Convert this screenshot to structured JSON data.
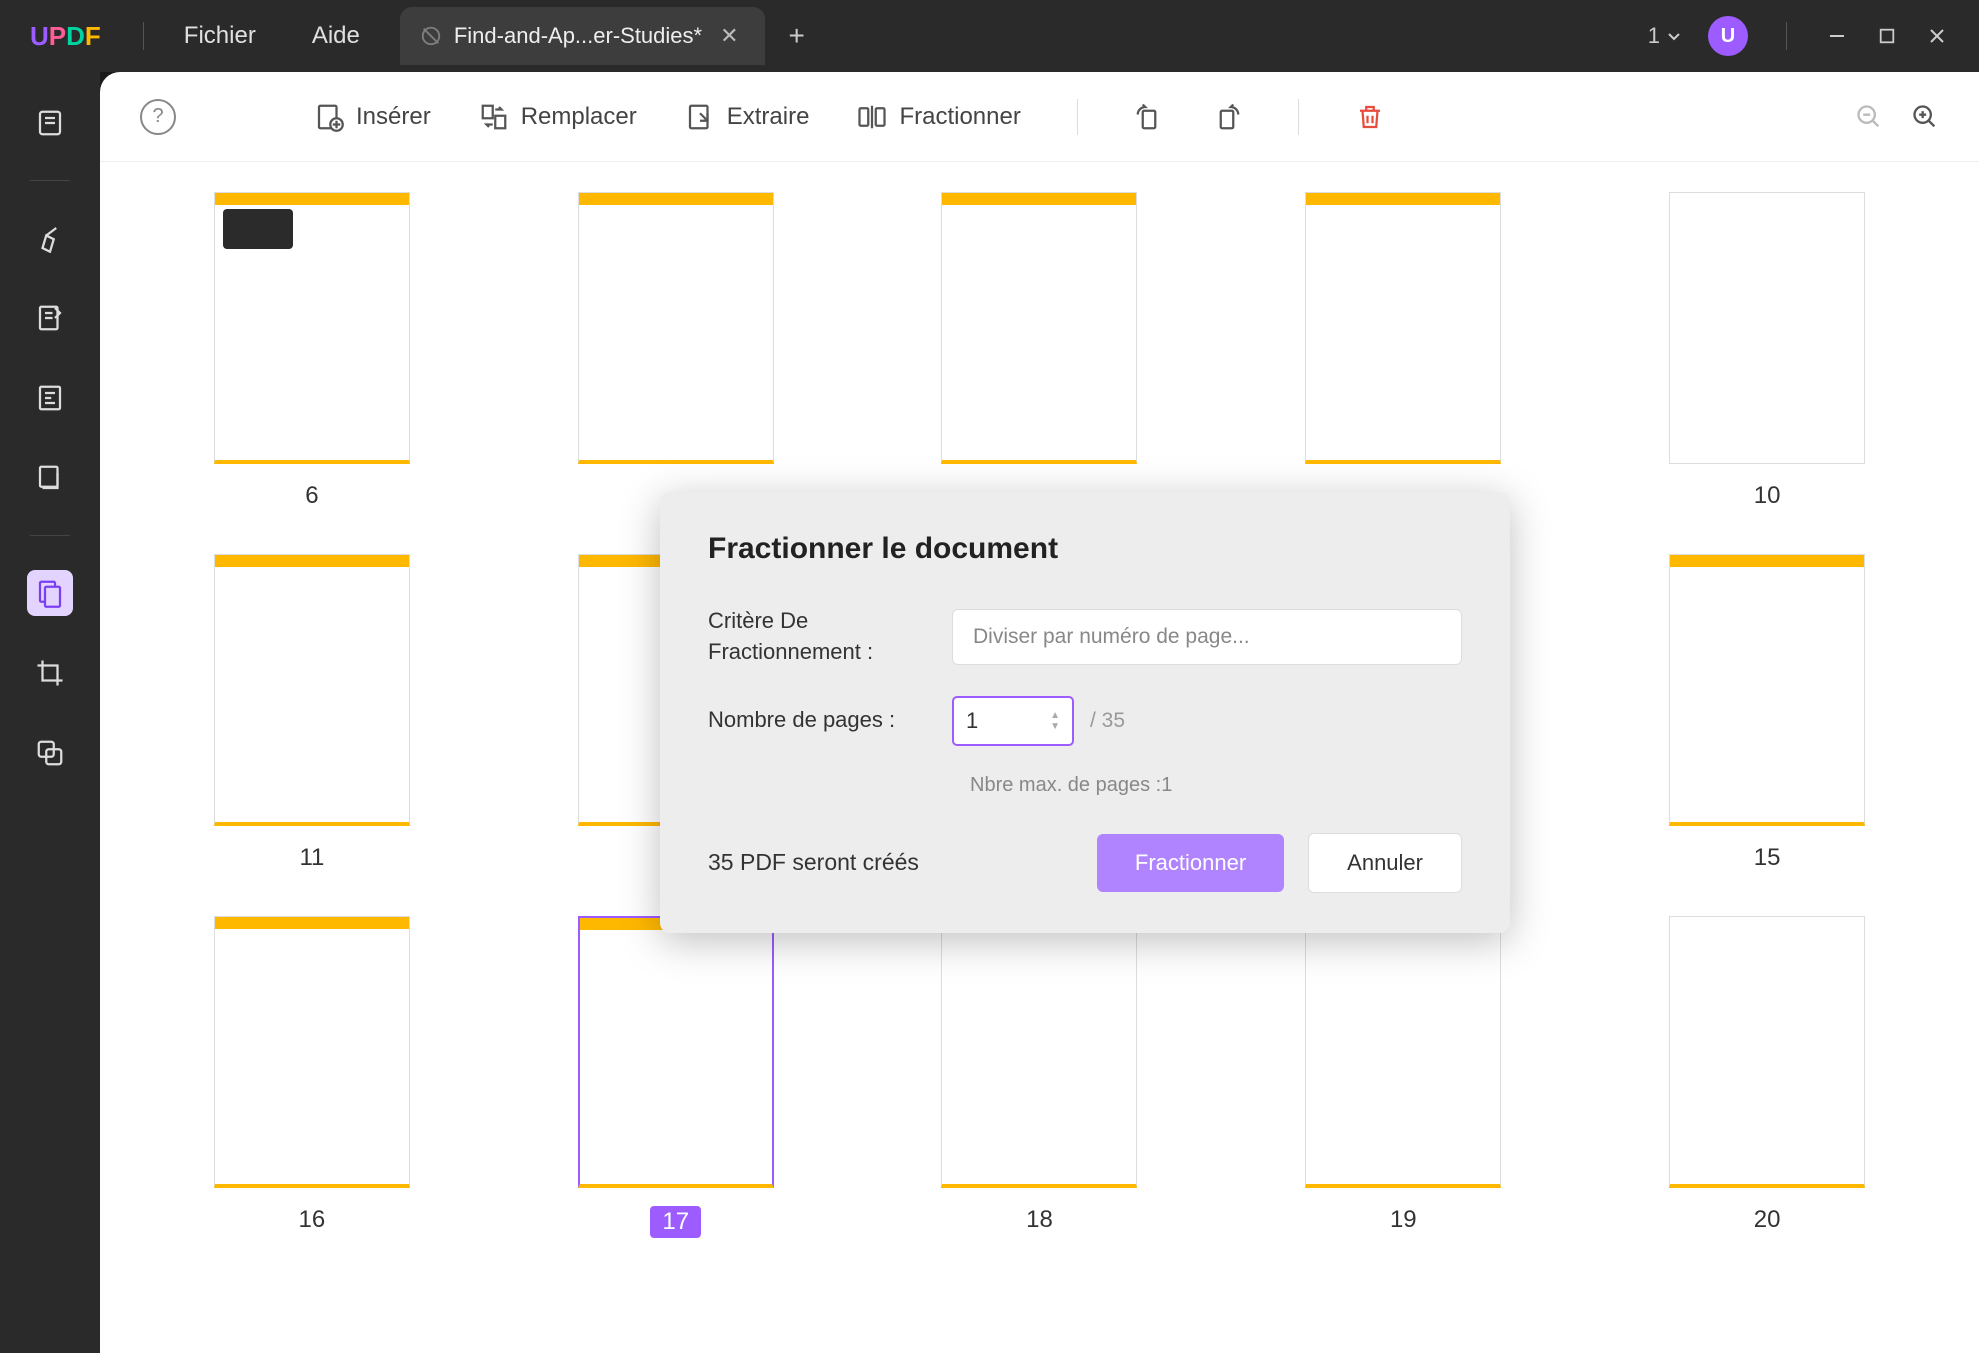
{
  "titlebar": {
    "menu": {
      "file": "Fichier",
      "help": "Aide"
    },
    "tab": {
      "title": "Find-and-Ap...er-Studies*"
    },
    "window_count": "1"
  },
  "toolbar": {
    "help": "?",
    "insert": "Insérer",
    "replace": "Remplacer",
    "extract": "Extraire",
    "split": "Fractionner"
  },
  "thumbnails": {
    "row1": [
      "6",
      "",
      "",
      "",
      "10"
    ],
    "row2": [
      "11",
      "",
      "",
      "",
      "15"
    ],
    "row3": [
      "16",
      "17",
      "18",
      "19",
      "20"
    ]
  },
  "dialog": {
    "title": "Fractionner le document",
    "criterion_label": "Critère De Fractionnement :",
    "criterion_placeholder": "Diviser par numéro de page...",
    "pages_label": "Nombre de pages :",
    "pages_value": "1",
    "pages_total": "/ 35",
    "max_hint": "Nbre max. de pages :1",
    "status": "35 PDF seront créés",
    "confirm": "Fractionner",
    "cancel": "Annuler"
  }
}
